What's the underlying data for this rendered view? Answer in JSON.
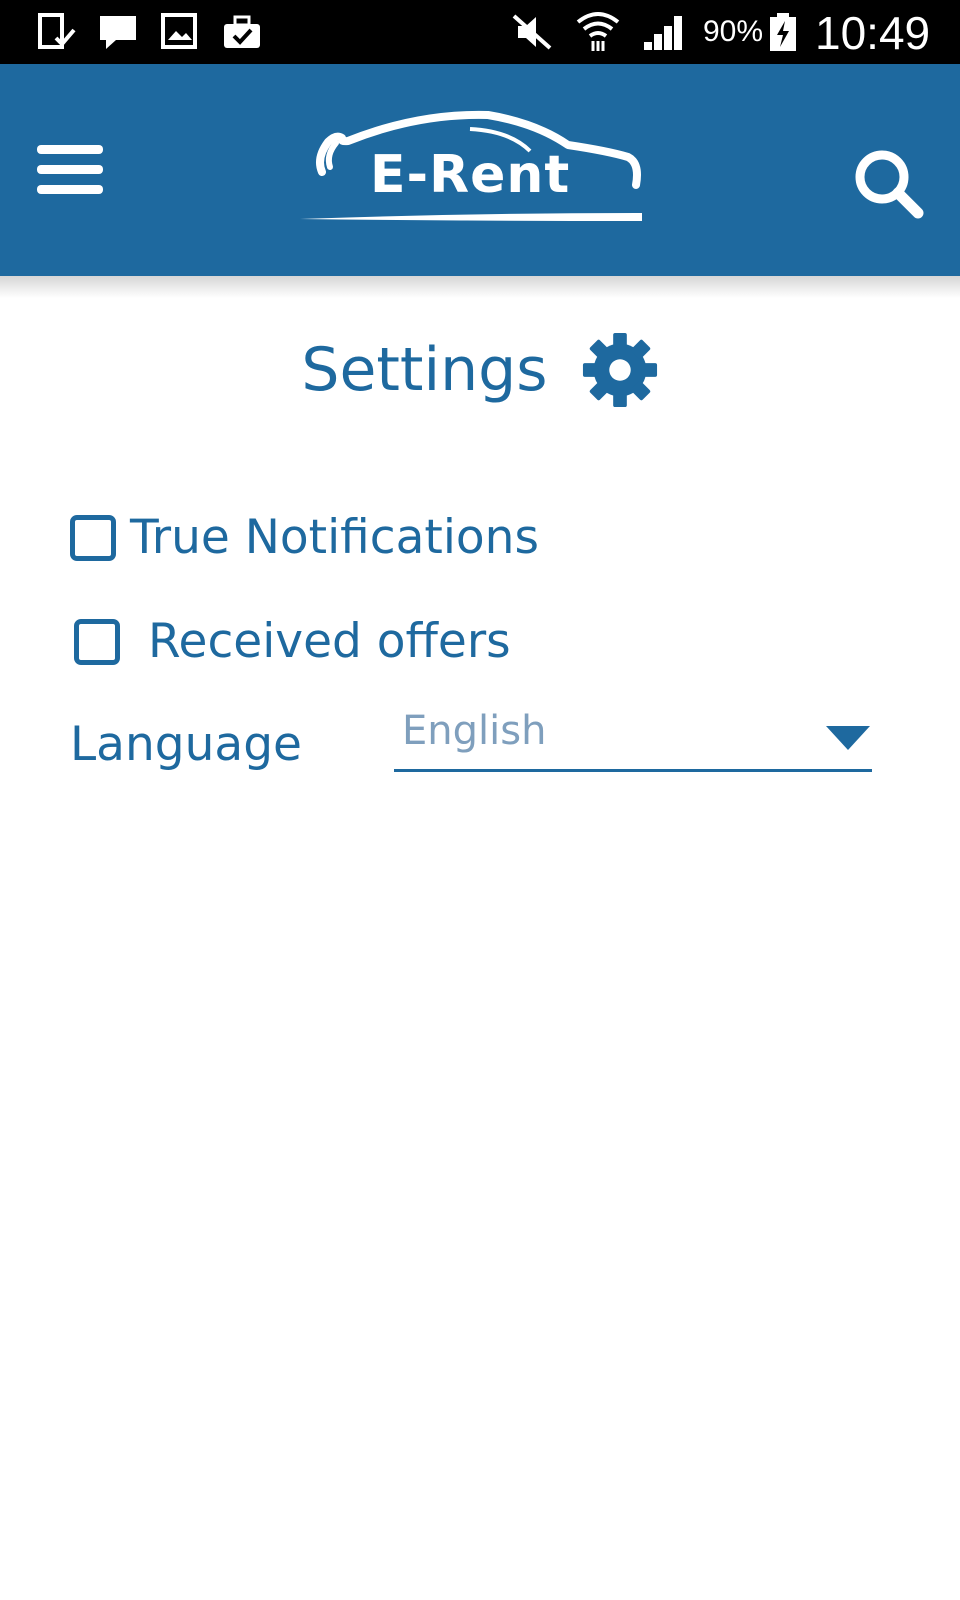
{
  "status_bar": {
    "notification_icons": [
      "download-done-icon",
      "chat-icon",
      "gallery-icon",
      "briefcase-check-icon"
    ],
    "system_icons": [
      "mute-icon",
      "wifi-icon",
      "signal-icon",
      "battery-charging-icon"
    ],
    "battery": "90%",
    "time": "10:49"
  },
  "app_bar": {
    "logo_text": "E-Rent",
    "menu_icon": "hamburger-menu-icon",
    "search_icon": "search-icon",
    "background_color": "#1e699f"
  },
  "settings": {
    "title": "Settings",
    "title_icon": "gear-icon",
    "options": [
      {
        "label": "True Notifications",
        "checked": false
      },
      {
        "label": "Received offers",
        "checked": false
      }
    ],
    "language": {
      "label": "Language",
      "value": "English"
    }
  },
  "colors": {
    "primary": "#1e699f",
    "muted_value": "#7f9fbd",
    "background": "#ffffff"
  }
}
